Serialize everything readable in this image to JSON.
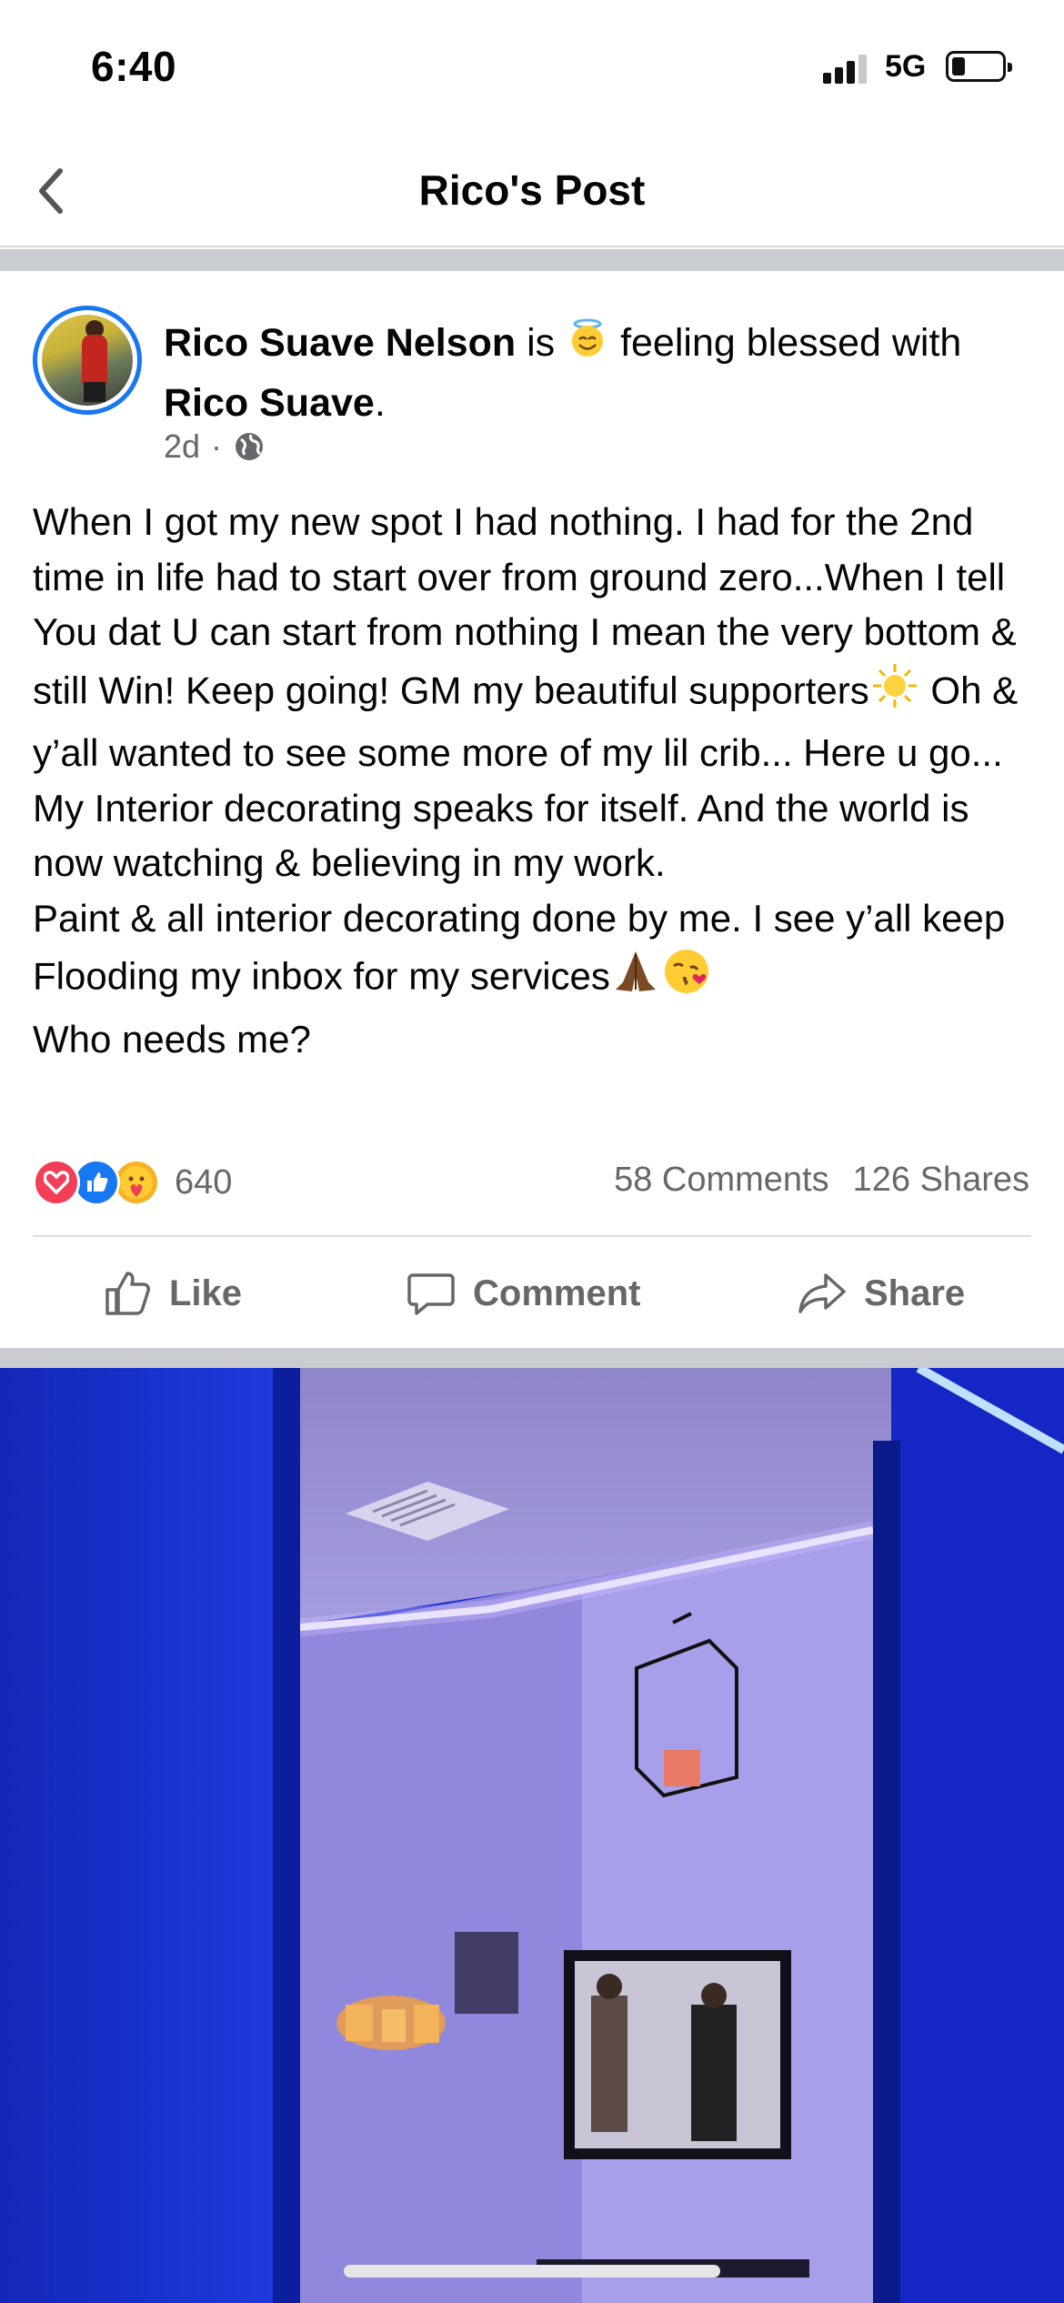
{
  "status_bar": {
    "time": "6:40",
    "network": "5G"
  },
  "header": {
    "title": "Rico's Post"
  },
  "post": {
    "author": "Rico Suave Nelson",
    "connector": "is",
    "feeling_text": "feeling blessed with",
    "with_name": "Rico Suave",
    "with_suffix": ".",
    "time_ago": "2d",
    "meta_dot": "·",
    "text_part1": "When I got my new spot I had nothing. I had for the 2nd time in life had to start over from ground zero...When I tell You dat U can start from nothing I mean the very bottom & still Win! Keep going! GM my beautiful supporters",
    "text_part2": " Oh & y’all wanted to see some more of my lil crib... Here u go... My Interior decorating speaks for itself. And the world is now watching & believing in my work.\nPaint & all interior decorating done by me. I see y’all keep Flooding my inbox for my services",
    "text_part3": "\nWho needs me?"
  },
  "engagement": {
    "reaction_count": "640",
    "comments": "58 Comments",
    "shares": "126 Shares"
  },
  "actions": {
    "like": "Like",
    "comment": "Comment",
    "share": "Share"
  },
  "icons": {
    "back": "chevron-left-icon",
    "privacy": "globe-icon",
    "feeling": "smiling-face-with-halo",
    "reactions": [
      "love-reaction",
      "like-reaction",
      "care-reaction"
    ]
  },
  "colors": {
    "brand": "#1877f2",
    "secondary_text": "#65676b",
    "love": "#f33e58"
  }
}
